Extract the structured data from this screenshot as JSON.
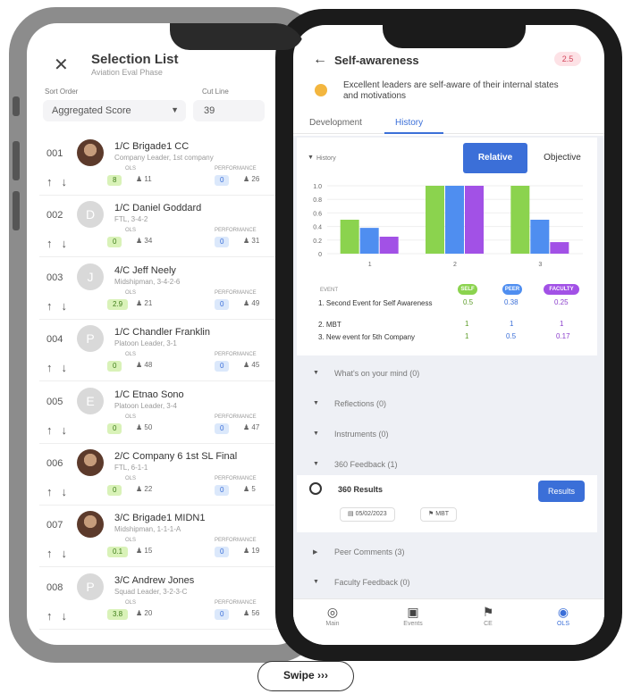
{
  "selection_list": {
    "title": "Selection List",
    "subtitle": "Aviation Eval Phase",
    "sort_label": "Sort Order",
    "cut_label": "Cut Line",
    "sort_value": "Aggregated Score",
    "cut_value": "39",
    "ols_label": "OLS",
    "perf_label": "PERFORMANCE",
    "rows": [
      {
        "num": "001",
        "name": "1/C Brigade1 CC",
        "role": "Company Leader, 1st company",
        "ols": "8",
        "ols_count": "11",
        "perf": "0",
        "perf_count": "26",
        "avatar": "photo"
      },
      {
        "num": "002",
        "name": "1/C Daniel Goddard",
        "role": "FTL, 3-4-2",
        "ols": "0",
        "ols_count": "34",
        "perf": "0",
        "perf_count": "31",
        "avatar": "D"
      },
      {
        "num": "003",
        "name": "4/C Jeff Neely",
        "role": "Midshipman, 3-4-2-6",
        "ols": "2.9",
        "ols_count": "21",
        "perf": "0",
        "perf_count": "49",
        "avatar": "J"
      },
      {
        "num": "004",
        "name": "1/C Chandler Franklin",
        "role": "Platoon Leader, 3-1",
        "ols": "0",
        "ols_count": "48",
        "perf": "0",
        "perf_count": "45",
        "avatar": "P"
      },
      {
        "num": "005",
        "name": "1/C Etnao Sono",
        "role": "Platoon Leader, 3-4",
        "ols": "0",
        "ols_count": "50",
        "perf": "0",
        "perf_count": "47",
        "avatar": "E"
      },
      {
        "num": "006",
        "name": "2/C Company 6 1st SL Final",
        "role": "FTL, 6-1-1",
        "ols": "0",
        "ols_count": "22",
        "perf": "0",
        "perf_count": "5",
        "avatar": "photo"
      },
      {
        "num": "007",
        "name": "3/C Brigade1 MIDN1",
        "role": "Midshipman, 1-1-1-A",
        "ols": "0.1",
        "ols_count": "15",
        "perf": "0",
        "perf_count": "19",
        "avatar": "photo"
      },
      {
        "num": "008",
        "name": "3/C Andrew Jones",
        "role": "Squad Leader, 3-2-3-C",
        "ols": "3.8",
        "ols_count": "20",
        "perf": "0",
        "perf_count": "56",
        "avatar": "P"
      }
    ]
  },
  "self_awareness": {
    "title": "Self-awareness",
    "score": "2.5",
    "quote": "Excellent leaders are self-aware of their internal states and motivations",
    "tabs": [
      "Development",
      "History"
    ],
    "history_label": "History",
    "toggle_relative": "Relative",
    "toggle_objective": "Objective",
    "event_header": "EVENT",
    "pills": [
      "SELF",
      "PEER",
      "FACULTY"
    ],
    "events": [
      {
        "label": "1. Second Event for Self Awareness",
        "self": "0.5",
        "peer": "0.38",
        "faculty": "0.25"
      },
      {
        "label": "2. MBT",
        "self": "1",
        "peer": "1",
        "faculty": "1"
      },
      {
        "label": "3. New event for 5th Company",
        "self": "1",
        "peer": "0.5",
        "faculty": "0.17"
      }
    ],
    "accordions": [
      "What's on your mind (0)",
      "Reflections (0)",
      "Instruments (0)",
      "360 Feedback (1)",
      "Peer Comments (3)",
      "Faculty Feedback (0)"
    ],
    "result_title": "360 Results",
    "result_button": "Results",
    "result_date": "05/02/2023",
    "result_tag": "MBT"
  },
  "bottom_nav": [
    "Main",
    "Events",
    "CE",
    "OLS"
  ],
  "swipe_label": "Swipe",
  "swipe_arrows": "›››",
  "chart_data": {
    "type": "bar",
    "categories": [
      "1",
      "2",
      "3"
    ],
    "series": [
      {
        "name": "SELF",
        "values": [
          0.5,
          1,
          1
        ],
        "color": "#8bd34e"
      },
      {
        "name": "PEER",
        "values": [
          0.38,
          1,
          0.5
        ],
        "color": "#4f8ef0"
      },
      {
        "name": "FACULTY",
        "values": [
          0.25,
          1,
          0.17
        ],
        "color": "#a251e6"
      }
    ],
    "yticks": [
      "0",
      "0.2",
      "0.4",
      "0.6",
      "0.8",
      "1.0"
    ],
    "ylim": [
      0,
      1
    ]
  }
}
